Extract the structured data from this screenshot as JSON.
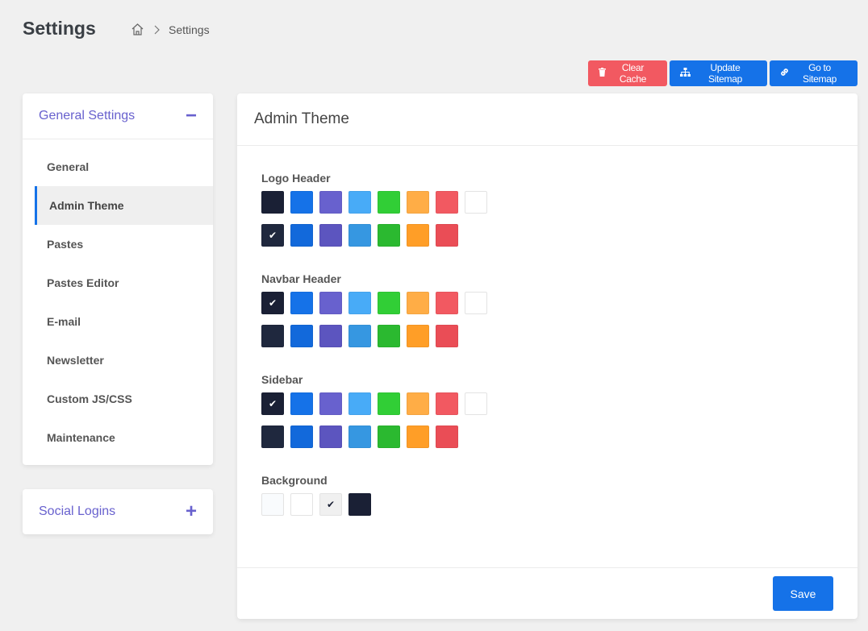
{
  "header": {
    "title": "Settings",
    "breadcrumb": {
      "current": "Settings"
    }
  },
  "actions": {
    "clear_cache": "Clear Cache",
    "update_sitemap": "Update Sitemap",
    "go_to_sitemap": "Go to Sitemap"
  },
  "sidebar": {
    "general": {
      "title": "General Settings",
      "toggle": "−",
      "items": [
        {
          "label": "General"
        },
        {
          "label": "Admin Theme"
        },
        {
          "label": "Pastes"
        },
        {
          "label": "Pastes Editor"
        },
        {
          "label": "E-mail"
        },
        {
          "label": "Newsletter"
        },
        {
          "label": "Custom JS/CSS"
        },
        {
          "label": "Maintenance"
        }
      ],
      "active_item": "Admin Theme"
    },
    "social": {
      "title": "Social Logins",
      "toggle": "+"
    }
  },
  "main": {
    "title": "Admin Theme",
    "sections": {
      "logo_header": {
        "label": "Logo Header"
      },
      "navbar_header": {
        "label": "Navbar Header"
      },
      "sidebar": {
        "label": "Sidebar"
      },
      "background": {
        "label": "Background"
      }
    },
    "save_label": "Save"
  },
  "colors": {
    "accent": "#6861ce",
    "primary": "#1572e8",
    "danger": "#f25961",
    "row1": [
      "#1a2035",
      "#1572e8",
      "#6861ce",
      "#48abf7",
      "#31ce36",
      "#ffad46",
      "#f25961",
      "#ffffff"
    ],
    "row2": [
      "#1f283e",
      "#1269db",
      "#5c55bf",
      "#3697e1",
      "#2bb930",
      "#ff9e27",
      "#ea4d56"
    ],
    "background": [
      "#f9fbfd",
      "#ffffff",
      "#f0f0f0",
      "#1a2035"
    ],
    "selected": {
      "logo_header": "#1f283e",
      "navbar_header": "#1a2035",
      "sidebar": "#1a2035",
      "background": "#f0f0f0"
    }
  }
}
